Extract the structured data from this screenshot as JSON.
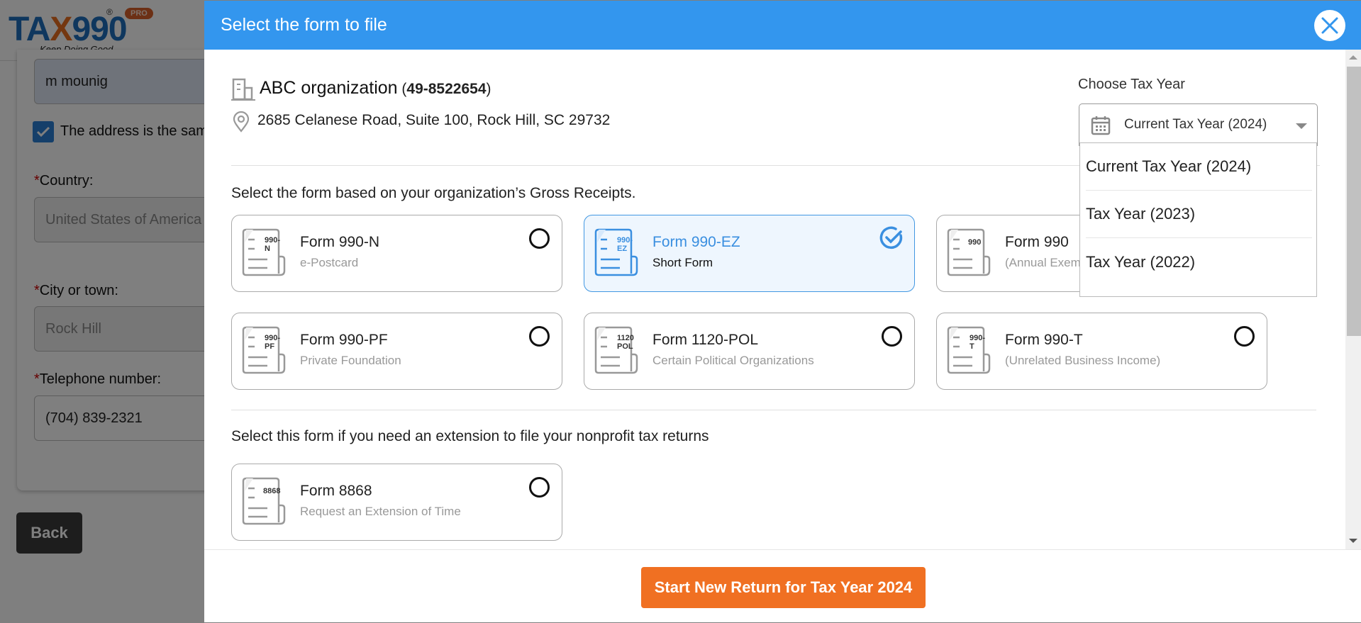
{
  "background": {
    "logo": {
      "brand_prefix": "TA",
      "brand_x": "X",
      "brand_suffix": "990",
      "registered": "®",
      "badge": "PRO",
      "tagline": "Keep Doing Good"
    },
    "fields": {
      "name_value": "m mounig",
      "same_address_label": "The address is the sam",
      "same_address_checked": true,
      "country_label": "Country:",
      "country_value": "United States of America",
      "city_label": "City or town:",
      "city_value": "Rock Hill",
      "phone_label": "Telephone number:",
      "phone_value": "(704) 839-2321",
      "required_mark": "*"
    },
    "back_label": "Back"
  },
  "modal": {
    "title": "Select the form to file",
    "close_icon": "close-icon",
    "organization": {
      "name": "ABC organization",
      "ein_open": " (",
      "ein": "49-8522654",
      "ein_close": ")",
      "address": "2685 Celanese Road, Suite 100, Rock Hill, SC 29732"
    },
    "tax_year": {
      "label": "Choose Tax Year",
      "selected": "Current Tax Year (2024)",
      "options": [
        "Current Tax Year (2024)",
        "Tax Year (2023)",
        "Tax Year (2022)"
      ],
      "dropdown_open": true
    },
    "gross_receipts_section": {
      "title": "Select the form based on your organization’s Gross Receipts.",
      "forms": [
        {
          "icon_code": "990-N",
          "title": "Form 990-N",
          "subtitle": "e-Postcard",
          "selected": false
        },
        {
          "icon_code": "990-EZ",
          "title": "Form 990-EZ",
          "subtitle": "Short Form",
          "selected": true
        },
        {
          "icon_code": "990",
          "title": "Form 990",
          "subtitle": "(Annual Exempt Organization Return)",
          "selected": false
        },
        {
          "icon_code": "990-PF",
          "title": "Form 990-PF",
          "subtitle": "Private Foundation",
          "selected": false
        },
        {
          "icon_code": "1120 POL",
          "title": "Form 1120-POL",
          "subtitle": "Certain Political Organizations",
          "selected": false
        },
        {
          "icon_code": "990-T",
          "title": "Form 990-T",
          "subtitle": "(Unrelated Business Income)",
          "selected": false
        }
      ]
    },
    "extension_section": {
      "title": "Select this form if you need an extension to file your nonprofit tax returns",
      "forms": [
        {
          "icon_code": "8868",
          "title": "Form 8868",
          "subtitle": "Request an Extension of Time",
          "selected": false
        }
      ]
    },
    "primary_button": "Start New Return for Tax Year 2024"
  },
  "colors": {
    "header_blue": "#3396ee",
    "selected_blue": "#3a8fe0",
    "primary_orange": "#f07022"
  }
}
